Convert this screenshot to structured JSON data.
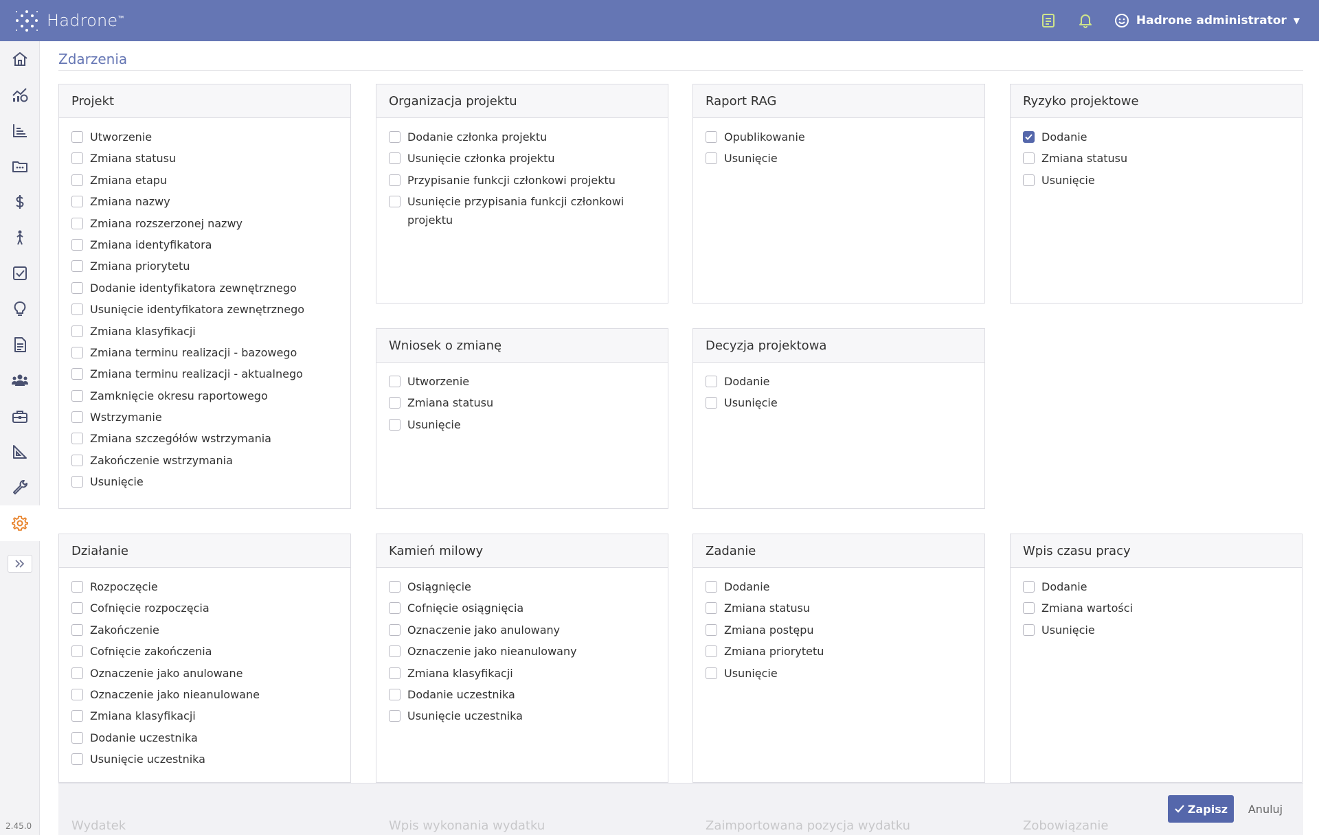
{
  "app": {
    "name": "Hadrone",
    "trademark": "™",
    "version": "2.45.0"
  },
  "user": {
    "name": "Hadrone administrator"
  },
  "page": {
    "title": "Zdarzenia"
  },
  "sidebar": {
    "icons": [
      "home-icon",
      "analytics-icon",
      "chart-icon",
      "portfolio-icon",
      "dollar-icon",
      "person-icon",
      "checkbox-icon",
      "lightbulb-icon",
      "document-icon",
      "users-icon",
      "toolbox-icon",
      "triangle-ruler-icon",
      "wrench-icon",
      "gear-icon"
    ],
    "active": "gear-icon"
  },
  "colors": {
    "brand": "#6576b4",
    "active_icon": "#e8822a",
    "checked": "#5567ab"
  },
  "panels": {
    "projekt": {
      "title": "Projekt",
      "options": [
        {
          "label": "Utworzenie",
          "checked": false
        },
        {
          "label": "Zmiana statusu",
          "checked": false
        },
        {
          "label": "Zmiana etapu",
          "checked": false
        },
        {
          "label": "Zmiana nazwy",
          "checked": false
        },
        {
          "label": "Zmiana rozszerzonej nazwy",
          "checked": false
        },
        {
          "label": "Zmiana identyfikatora",
          "checked": false
        },
        {
          "label": "Zmiana priorytetu",
          "checked": false
        },
        {
          "label": "Dodanie identyfikatora zewnętrznego",
          "checked": false
        },
        {
          "label": "Usunięcie identyfikatora zewnętrznego",
          "checked": false
        },
        {
          "label": "Zmiana klasyfikacji",
          "checked": false
        },
        {
          "label": "Zmiana terminu realizacji - bazowego",
          "checked": false
        },
        {
          "label": "Zmiana terminu realizacji - aktualnego",
          "checked": false
        },
        {
          "label": "Zamknięcie okresu raportowego",
          "checked": false
        },
        {
          "label": "Wstrzymanie",
          "checked": false
        },
        {
          "label": "Zmiana szczegółów wstrzymania",
          "checked": false
        },
        {
          "label": "Zakończenie wstrzymania",
          "checked": false
        },
        {
          "label": "Usunięcie",
          "checked": false
        }
      ]
    },
    "organizacja": {
      "title": "Organizacja projektu",
      "options": [
        {
          "label": "Dodanie członka projektu",
          "checked": false
        },
        {
          "label": "Usunięcie członka projektu",
          "checked": false
        },
        {
          "label": "Przypisanie funkcji członkowi projektu",
          "checked": false
        },
        {
          "label": "Usunięcie przypisania funkcji członkowi projektu",
          "checked": false
        }
      ]
    },
    "raport": {
      "title": "Raport RAG",
      "options": [
        {
          "label": "Opublikowanie",
          "checked": false
        },
        {
          "label": "Usunięcie",
          "checked": false
        }
      ]
    },
    "ryzyko": {
      "title": "Ryzyko projektowe",
      "options": [
        {
          "label": "Dodanie",
          "checked": true
        },
        {
          "label": "Zmiana statusu",
          "checked": false
        },
        {
          "label": "Usunięcie",
          "checked": false
        }
      ]
    },
    "wniosek": {
      "title": "Wniosek o zmianę",
      "options": [
        {
          "label": "Utworzenie",
          "checked": false
        },
        {
          "label": "Zmiana statusu",
          "checked": false
        },
        {
          "label": "Usunięcie",
          "checked": false
        }
      ]
    },
    "decyzja": {
      "title": "Decyzja projektowa",
      "options": [
        {
          "label": "Dodanie",
          "checked": false
        },
        {
          "label": "Usunięcie",
          "checked": false
        }
      ]
    },
    "dzialanie": {
      "title": "Działanie",
      "options": [
        {
          "label": "Rozpoczęcie",
          "checked": false
        },
        {
          "label": "Cofnięcie rozpoczęcia",
          "checked": false
        },
        {
          "label": "Zakończenie",
          "checked": false
        },
        {
          "label": "Cofnięcie zakończenia",
          "checked": false
        },
        {
          "label": "Oznaczenie jako anulowane",
          "checked": false
        },
        {
          "label": "Oznaczenie jako nieanulowane",
          "checked": false
        },
        {
          "label": "Zmiana klasyfikacji",
          "checked": false
        },
        {
          "label": "Dodanie uczestnika",
          "checked": false
        },
        {
          "label": "Usunięcie uczestnika",
          "checked": false
        }
      ]
    },
    "kamien": {
      "title": "Kamień milowy",
      "options": [
        {
          "label": "Osiągnięcie",
          "checked": false
        },
        {
          "label": "Cofnięcie osiągnięcia",
          "checked": false
        },
        {
          "label": "Oznaczenie jako anulowany",
          "checked": false
        },
        {
          "label": "Oznaczenie jako nieanulowany",
          "checked": false
        },
        {
          "label": "Zmiana klasyfikacji",
          "checked": false
        },
        {
          "label": "Dodanie uczestnika",
          "checked": false
        },
        {
          "label": "Usunięcie uczestnika",
          "checked": false
        }
      ]
    },
    "zadanie": {
      "title": "Zadanie",
      "options": [
        {
          "label": "Dodanie",
          "checked": false
        },
        {
          "label": "Zmiana statusu",
          "checked": false
        },
        {
          "label": "Zmiana postępu",
          "checked": false
        },
        {
          "label": "Zmiana priorytetu",
          "checked": false
        },
        {
          "label": "Usunięcie",
          "checked": false
        }
      ]
    },
    "wpis": {
      "title": "Wpis czasu pracy",
      "options": [
        {
          "label": "Dodanie",
          "checked": false
        },
        {
          "label": "Zmiana wartości",
          "checked": false
        },
        {
          "label": "Usunięcie",
          "checked": false
        }
      ]
    }
  },
  "faded_panels": [
    "Wydatek",
    "Wpis wykonania wydatku",
    "Zaimportowana pozycja wydatku",
    "Zobowiązanie"
  ],
  "actions": {
    "save": "Zapisz",
    "cancel": "Anuluj"
  }
}
